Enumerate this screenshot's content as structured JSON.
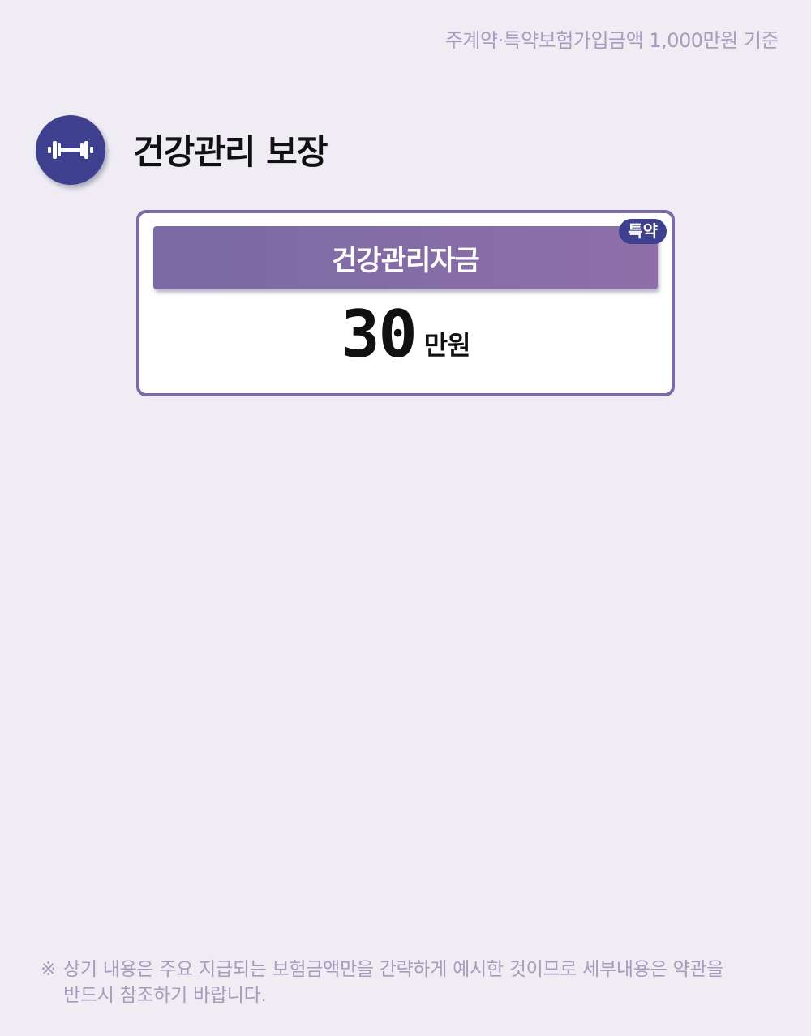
{
  "basis_note": "주계약·특약보험가입금액 1,000만원 기준",
  "section": {
    "icon": "dumbbell-icon",
    "title": "건강관리 보장"
  },
  "card": {
    "label": "건강관리자금",
    "badge": "특약",
    "amount": "30",
    "unit": "만원"
  },
  "disclaimer": {
    "mark": "※",
    "line1": "상기 내용은 주요 지급되는 보험금액만을 간략하게 예시한 것이므로 세부내용은 약관을",
    "line2": "반드시 참조하기 바랍니다."
  },
  "colors": {
    "background": "#efecf4",
    "accent_navy": "#3f3f8f",
    "accent_purple": "#7a6aa5",
    "muted_text": "#a99bbd"
  }
}
